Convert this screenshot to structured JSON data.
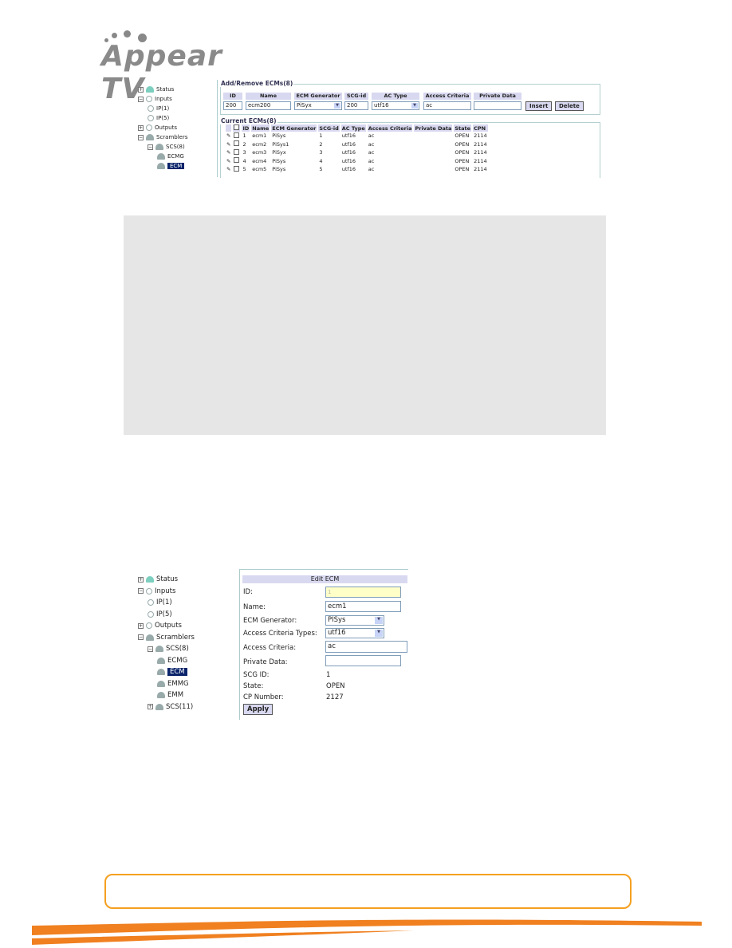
{
  "logo": {
    "text": "Appear TV"
  },
  "top_screenshot": {
    "tree": [
      {
        "label": "Status",
        "icon": "status-icon",
        "expander": "+"
      },
      {
        "label": "Inputs",
        "icon": "input-icon",
        "expander": "-"
      },
      {
        "label": "IP(1)",
        "icon": "input-icon"
      },
      {
        "label": "IP(5)",
        "icon": "input-icon"
      },
      {
        "label": "Outputs",
        "icon": "output-icon",
        "expander": "+"
      },
      {
        "label": "Scramblers",
        "icon": "lock-icon",
        "expander": "-"
      },
      {
        "label": "SCS(8)",
        "icon": "lock-icon",
        "expander": "-"
      },
      {
        "label": "ECMG",
        "icon": "lock-icon"
      },
      {
        "label": "ECM",
        "icon": "lock-icon",
        "selected": true
      }
    ],
    "add_remove": {
      "title": "Add/Remove ECMs(8)",
      "headers": [
        "ID",
        "Name",
        "ECM Generator",
        "SCG-id",
        "AC Type",
        "Access Criteria",
        "Private Data"
      ],
      "values": {
        "id": "200",
        "name": "ecm200",
        "ecm_generator": "PiSyx",
        "scg_id": "200",
        "ac_type": "utf16",
        "access_criteria": "ac",
        "private_data": ""
      },
      "insert_label": "Insert",
      "delete_label": "Delete"
    },
    "current": {
      "title": "Current ECMs(8)",
      "headers": [
        "ID",
        "Name",
        "ECM Generator",
        "SCG-id",
        "AC Type",
        "Access Criteria",
        "Private Data",
        "State",
        "CPN"
      ],
      "rows": [
        [
          "1",
          "ecm1",
          "PiSys",
          "1",
          "utf16",
          "ac",
          "",
          "OPEN",
          "2114"
        ],
        [
          "2",
          "ecm2",
          "PiSys1",
          "2",
          "utf16",
          "ac",
          "",
          "OPEN",
          "2114"
        ],
        [
          "3",
          "ecm3",
          "PiSyx",
          "3",
          "utf16",
          "ac",
          "",
          "OPEN",
          "2114"
        ],
        [
          "4",
          "ecm4",
          "PiSys",
          "4",
          "utf16",
          "ac",
          "",
          "OPEN",
          "2114"
        ],
        [
          "5",
          "ecm5",
          "PiSys",
          "5",
          "utf16",
          "ac",
          "",
          "OPEN",
          "2114"
        ]
      ]
    }
  },
  "bottom_screenshot": {
    "tree": [
      {
        "label": "Status",
        "expander": "+"
      },
      {
        "label": "Inputs",
        "expander": "-"
      },
      {
        "label": "IP(1)"
      },
      {
        "label": "IP(5)"
      },
      {
        "label": "Outputs",
        "expander": "+"
      },
      {
        "label": "Scramblers",
        "expander": "-"
      },
      {
        "label": "SCS(8)",
        "expander": "-"
      },
      {
        "label": "ECMG"
      },
      {
        "label": "ECM",
        "selected": true
      },
      {
        "label": "EMMG"
      },
      {
        "label": "EMM"
      },
      {
        "label": "SCS(11)",
        "expander": "+"
      }
    ],
    "edit": {
      "title": "Edit ECM",
      "id_label": "ID:",
      "id_value": "1",
      "name_label": "Name:",
      "name_value": "ecm1",
      "gen_label": "ECM Generator:",
      "gen_value": "PISys",
      "act_label": "Access Criteria Types:",
      "act_value": "utf16",
      "ac_label": "Access Criteria:",
      "ac_value": "ac",
      "pd_label": "Private Data:",
      "pd_value": "",
      "scg_label": "SCG ID:",
      "scg_value": "1",
      "state_label": "State:",
      "state_value": "OPEN",
      "cp_label": "CP Number:",
      "cp_value": "2127",
      "apply_label": "Apply"
    }
  },
  "colors": {
    "accent": "#f5a020",
    "header_bg": "#d8d8f0",
    "selected": "#0a246a"
  }
}
